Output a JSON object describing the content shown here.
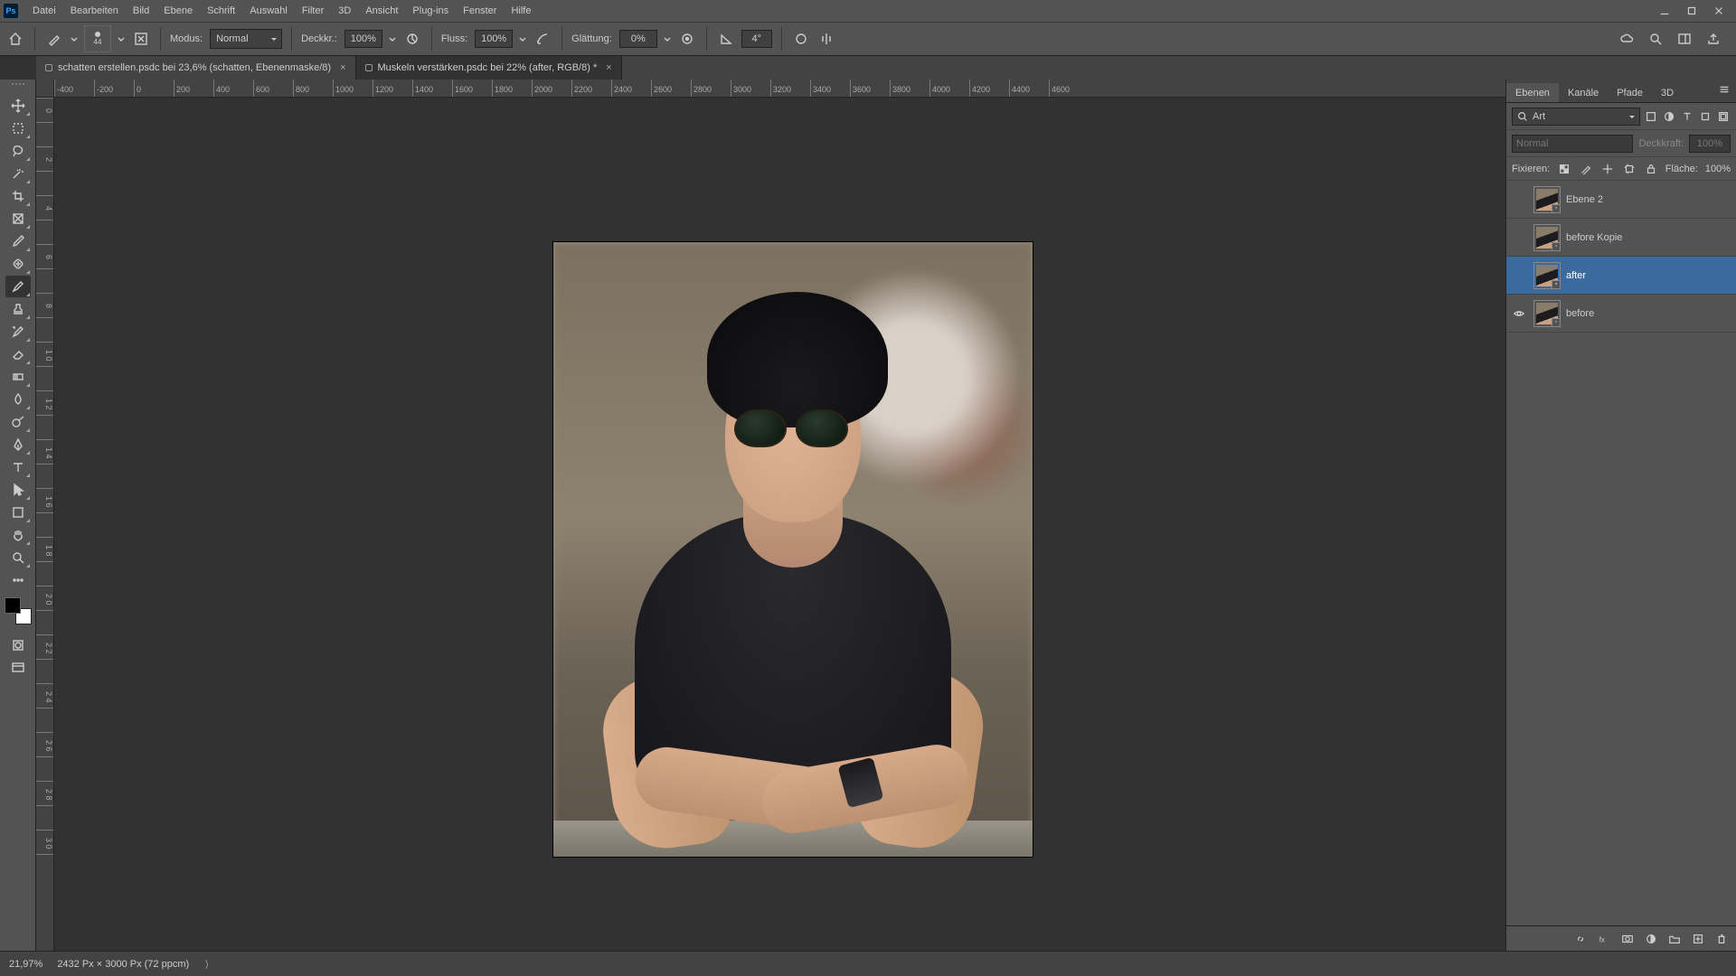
{
  "menubar": {
    "items": [
      "Datei",
      "Bearbeiten",
      "Bild",
      "Ebene",
      "Schrift",
      "Auswahl",
      "Filter",
      "3D",
      "Ansicht",
      "Plug-ins",
      "Fenster",
      "Hilfe"
    ]
  },
  "optionsbar": {
    "brush_size": "44",
    "mode_label": "Modus:",
    "mode_value": "Normal",
    "opacity_label": "Deckkr.:",
    "opacity_value": "100%",
    "flow_label": "Fluss:",
    "flow_value": "100%",
    "smoothing_label": "Glättung:",
    "smoothing_value": "0%",
    "angle_value": "4°"
  },
  "tabs": [
    {
      "title": "schatten erstellen.psdc bei 23,6% (schatten, Ebenenmaske/8)",
      "active": false
    },
    {
      "title": "Muskeln verstärken.psdc bei 22% (after, RGB/8) *",
      "active": true
    }
  ],
  "ruler_h": [
    "-400",
    "-200",
    "0",
    "200",
    "400",
    "600",
    "800",
    "1000",
    "1200",
    "1400",
    "1600",
    "1800",
    "2000",
    "2200",
    "2400",
    "2600",
    "2800",
    "3000",
    "3200",
    "3400",
    "3600",
    "3800",
    "4000",
    "4200",
    "4400",
    "4600"
  ],
  "ruler_v": [
    "0",
    "",
    "2",
    "",
    "4",
    "",
    "6",
    "",
    "8",
    "",
    "1 0",
    "",
    "1 2",
    "",
    "1 4",
    "",
    "1 6",
    "",
    "1 8",
    "",
    "2 0",
    "",
    "2 2",
    "",
    "2 4",
    "",
    "2 6",
    "",
    "2 8",
    "",
    "3 0",
    ""
  ],
  "panels": {
    "tabs": [
      "Ebenen",
      "Kanäle",
      "Pfade",
      "3D"
    ],
    "active_tab": 0,
    "search_label": "Art",
    "blend_mode": "Normal",
    "opacity_label": "Deckkraft:",
    "opacity_value": "100%",
    "lock_label": "Fixieren:",
    "fill_label": "Fläche:",
    "fill_value": "100%",
    "layers": [
      {
        "name": "Ebene 2",
        "visible": false,
        "selected": false
      },
      {
        "name": "before Kopie",
        "visible": false,
        "selected": false
      },
      {
        "name": "after",
        "visible": false,
        "selected": true
      },
      {
        "name": "before",
        "visible": true,
        "selected": false
      }
    ]
  },
  "statusbar": {
    "zoom": "21,97%",
    "docinfo": "2432 Px × 3000 Px (72 ppcm)"
  }
}
